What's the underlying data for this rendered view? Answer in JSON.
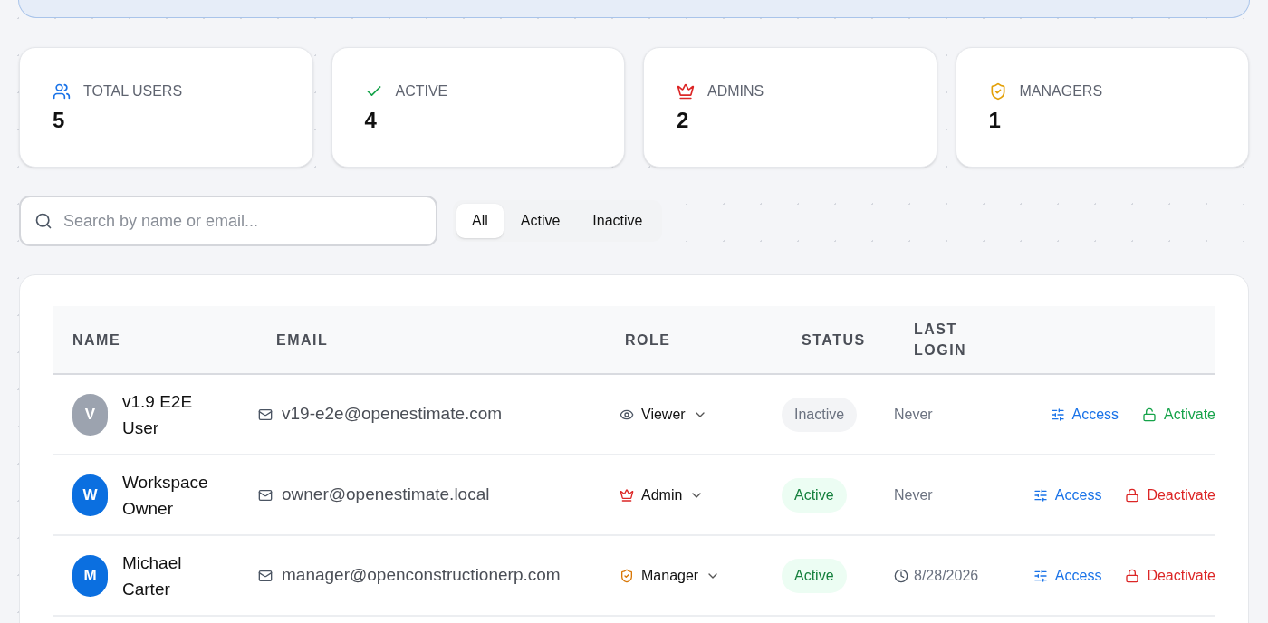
{
  "stats": [
    {
      "kind": "users",
      "label": "TOTAL USERS",
      "value": "5"
    },
    {
      "kind": "active",
      "label": "ACTIVE",
      "value": "4"
    },
    {
      "kind": "admins",
      "label": "ADMINS",
      "value": "2"
    },
    {
      "kind": "managers",
      "label": "MANAGERS",
      "value": "1"
    }
  ],
  "search": {
    "placeholder": "Search by name or email..."
  },
  "filters": [
    {
      "label": "All",
      "selected": true
    },
    {
      "label": "Active",
      "selected": false
    },
    {
      "label": "Inactive",
      "selected": false
    }
  ],
  "table": {
    "columns": [
      "NAME",
      "EMAIL",
      "ROLE",
      "STATUS",
      "LAST LOGIN"
    ],
    "rows": [
      {
        "initial": "V",
        "name": "v1.9 E2E User",
        "email": "v19-e2e@openestimate.com",
        "role": {
          "kind": "viewer",
          "label": "Viewer"
        },
        "status": {
          "kind": "inactive",
          "label": "Inactive"
        },
        "last_login": {
          "kind": "never",
          "text": "Never"
        },
        "actions": [
          {
            "kind": "access",
            "label": "Access"
          },
          {
            "kind": "activate",
            "label": "Activate"
          }
        ]
      },
      {
        "initial": "W",
        "name": "Workspace Owner",
        "email": "owner@openestimate.local",
        "role": {
          "kind": "admin",
          "label": "Admin"
        },
        "status": {
          "kind": "active",
          "label": "Active"
        },
        "last_login": {
          "kind": "never",
          "text": "Never"
        },
        "actions": [
          {
            "kind": "access",
            "label": "Access"
          },
          {
            "kind": "deactivate",
            "label": "Deactivate"
          }
        ]
      },
      {
        "initial": "M",
        "name": "Michael Carter",
        "email": "manager@openconstructionerp.com",
        "role": {
          "kind": "manager",
          "label": "Manager"
        },
        "status": {
          "kind": "active",
          "label": "Active"
        },
        "last_login": {
          "kind": "date",
          "text": "8/28/2026"
        },
        "actions": [
          {
            "kind": "access",
            "label": "Access"
          },
          {
            "kind": "deactivate",
            "label": "Deactivate"
          }
        ]
      }
    ]
  }
}
